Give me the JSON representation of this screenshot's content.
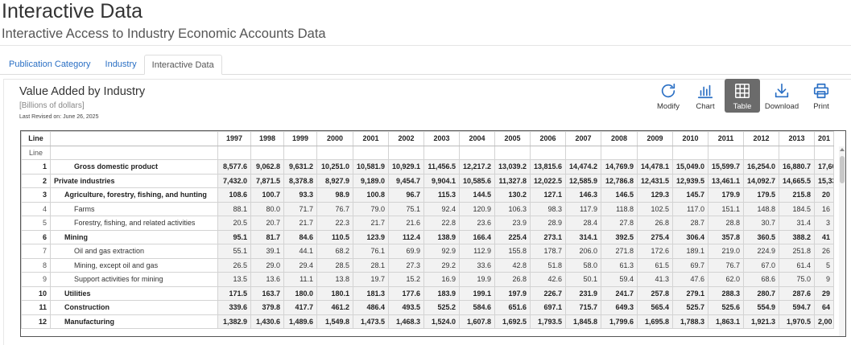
{
  "header": {
    "title": "Interactive Data",
    "subtitle": "Interactive Access to Industry Economic Accounts Data"
  },
  "tabs": [
    {
      "label": "Publication Category",
      "active": false
    },
    {
      "label": "Industry",
      "active": false
    },
    {
      "label": "Interactive Data",
      "active": true
    }
  ],
  "table_info": {
    "title": "Value Added by Industry",
    "units": "[Billions of dollars]",
    "revised": "Last Revised on: June 26, 2025"
  },
  "toolbar": {
    "modify": "Modify",
    "chart": "Chart",
    "table": "Table",
    "download": "Download",
    "print": "Print",
    "active": "table",
    "accent_color": "#2a6fc4"
  },
  "grid": {
    "line_header": "Line",
    "years": [
      "1997",
      "1998",
      "1999",
      "2000",
      "2001",
      "2002",
      "2003",
      "2004",
      "2005",
      "2006",
      "2007",
      "2008",
      "2009",
      "2010",
      "2011",
      "2012",
      "2013",
      "201"
    ],
    "filter_row_label": "Line",
    "rows": [
      {
        "line": "1",
        "name": "Gross domestic product",
        "indent": 3,
        "bold": true,
        "values": [
          "8,577.6",
          "9,062.8",
          "9,631.2",
          "10,251.0",
          "10,581.9",
          "10,929.1",
          "11,456.5",
          "12,217.2",
          "13,039.2",
          "13,815.6",
          "14,474.2",
          "14,769.9",
          "14,478.1",
          "15,049.0",
          "15,599.7",
          "16,254.0",
          "16,880.7",
          "17,60"
        ]
      },
      {
        "line": "2",
        "name": "Private industries",
        "indent": 0,
        "bold": true,
        "values": [
          "7,432.0",
          "7,871.5",
          "8,378.8",
          "8,927.9",
          "9,189.0",
          "9,454.7",
          "9,904.1",
          "10,585.6",
          "11,327.8",
          "12,022.5",
          "12,585.9",
          "12,786.8",
          "12,431.5",
          "12,939.5",
          "13,461.1",
          "14,092.7",
          "14,665.5",
          "15,33"
        ]
      },
      {
        "line": "3",
        "name": "Agriculture, forestry, fishing, and hunting",
        "indent": 1,
        "bold": true,
        "values": [
          "108.6",
          "100.7",
          "93.3",
          "98.9",
          "100.8",
          "96.7",
          "115.3",
          "144.5",
          "130.2",
          "127.1",
          "146.3",
          "146.5",
          "129.3",
          "145.7",
          "179.9",
          "179.5",
          "215.8",
          "20"
        ]
      },
      {
        "line": "4",
        "name": "Farms",
        "indent": 2,
        "bold": false,
        "values": [
          "88.1",
          "80.0",
          "71.7",
          "76.7",
          "79.0",
          "75.1",
          "92.4",
          "120.9",
          "106.3",
          "98.3",
          "117.9",
          "118.8",
          "102.5",
          "117.0",
          "151.1",
          "148.8",
          "184.5",
          "16"
        ]
      },
      {
        "line": "5",
        "name": "Forestry, fishing, and related activities",
        "indent": 2,
        "bold": false,
        "values": [
          "20.5",
          "20.7",
          "21.7",
          "22.3",
          "21.7",
          "21.6",
          "22.8",
          "23.6",
          "23.9",
          "28.9",
          "28.4",
          "27.8",
          "26.8",
          "28.7",
          "28.8",
          "30.7",
          "31.4",
          "3"
        ]
      },
      {
        "line": "6",
        "name": "Mining",
        "indent": 1,
        "bold": true,
        "values": [
          "95.1",
          "81.7",
          "84.6",
          "110.5",
          "123.9",
          "112.4",
          "138.9",
          "166.4",
          "225.4",
          "273.1",
          "314.1",
          "392.5",
          "275.4",
          "306.4",
          "357.8",
          "360.5",
          "388.2",
          "41"
        ]
      },
      {
        "line": "7",
        "name": "Oil and gas extraction",
        "indent": 2,
        "bold": false,
        "values": [
          "55.1",
          "39.1",
          "44.1",
          "68.2",
          "76.1",
          "69.9",
          "92.9",
          "112.9",
          "155.8",
          "178.7",
          "206.0",
          "271.8",
          "172.6",
          "189.1",
          "219.0",
          "224.9",
          "251.8",
          "26"
        ]
      },
      {
        "line": "8",
        "name": "Mining, except oil and gas",
        "indent": 2,
        "bold": false,
        "values": [
          "26.5",
          "29.0",
          "29.4",
          "28.5",
          "28.1",
          "27.3",
          "29.2",
          "33.6",
          "42.8",
          "51.8",
          "58.0",
          "61.3",
          "61.5",
          "69.7",
          "76.7",
          "67.0",
          "61.4",
          "5"
        ]
      },
      {
        "line": "9",
        "name": "Support activities for mining",
        "indent": 2,
        "bold": false,
        "values": [
          "13.5",
          "13.6",
          "11.1",
          "13.8",
          "19.7",
          "15.2",
          "16.9",
          "19.9",
          "26.8",
          "42.6",
          "50.1",
          "59.4",
          "41.3",
          "47.6",
          "62.0",
          "68.6",
          "75.0",
          "9"
        ]
      },
      {
        "line": "10",
        "name": "Utilities",
        "indent": 1,
        "bold": true,
        "values": [
          "171.5",
          "163.7",
          "180.0",
          "180.1",
          "181.3",
          "177.6",
          "183.9",
          "199.1",
          "197.9",
          "226.7",
          "231.9",
          "241.7",
          "257.8",
          "279.1",
          "288.3",
          "280.7",
          "287.6",
          "29"
        ]
      },
      {
        "line": "11",
        "name": "Construction",
        "indent": 1,
        "bold": true,
        "values": [
          "339.6",
          "379.8",
          "417.7",
          "461.2",
          "486.4",
          "493.5",
          "525.2",
          "584.6",
          "651.6",
          "697.1",
          "715.7",
          "649.3",
          "565.4",
          "525.7",
          "525.6",
          "554.9",
          "594.7",
          "64"
        ]
      },
      {
        "line": "12",
        "name": "Manufacturing",
        "indent": 1,
        "bold": true,
        "values": [
          "1,382.9",
          "1,430.6",
          "1,489.6",
          "1,549.8",
          "1,473.5",
          "1,468.3",
          "1,524.0",
          "1,607.8",
          "1,692.5",
          "1,793.5",
          "1,845.8",
          "1,799.6",
          "1,695.8",
          "1,788.3",
          "1,863.1",
          "1,921.3",
          "1,970.5",
          "2,00"
        ]
      }
    ]
  }
}
